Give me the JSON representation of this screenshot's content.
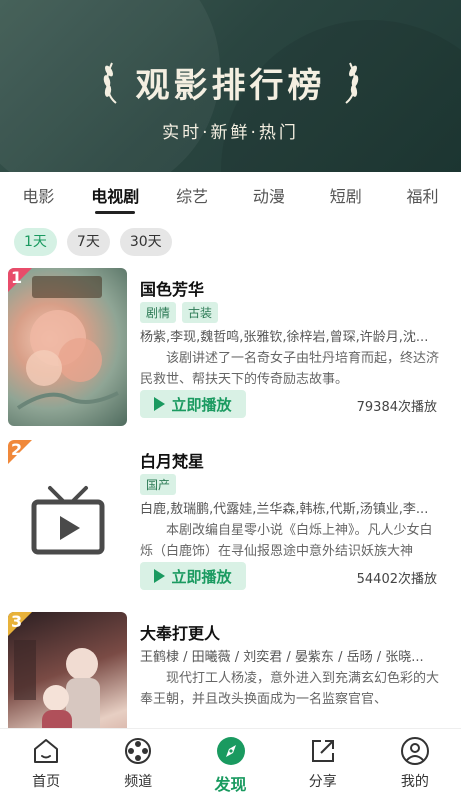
{
  "banner": {
    "title": "观影排行榜",
    "subtitle": "实时·新鲜·热门"
  },
  "tabs": [
    {
      "label": "电影",
      "active": false
    },
    {
      "label": "电视剧",
      "active": true
    },
    {
      "label": "综艺",
      "active": false
    },
    {
      "label": "动漫",
      "active": false
    },
    {
      "label": "短剧",
      "active": false
    },
    {
      "label": "福利",
      "active": false
    }
  ],
  "days": [
    {
      "label": "1天",
      "active": true
    },
    {
      "label": "7天",
      "active": false
    },
    {
      "label": "30天",
      "active": false
    }
  ],
  "items": [
    {
      "rank": "1",
      "rank_color": "#e84c6a",
      "title": "国色芳华",
      "tags": [
        "剧情",
        "古装"
      ],
      "cast": "杨紫,李现,魏哲鸣,张雅钦,徐梓岩,曾琛,许龄月,沈...",
      "desc": "该剧讲述了一名奇女子由牡丹培育而起，终达济民救世、帮扶天下的传奇励志故事。",
      "play_label": "立即播放",
      "count": "79384次播放",
      "poster_colors": [
        "#c9a890",
        "#e8b9a4",
        "#6f8a7a"
      ]
    },
    {
      "rank": "2",
      "rank_color": "#f0883a",
      "title": "白月梵星",
      "tags": [
        "国产"
      ],
      "cast": "白鹿,敖瑞鹏,代露娃,兰华森,韩栋,代斯,汤镇业,李...",
      "desc": "本剧改编自星零小说《白烁上神》。凡人少女白烁（白鹿饰）在寻仙报恩途中意外结识妖族大神",
      "play_label": "立即播放",
      "count": "54402次播放",
      "poster_colors": []
    },
    {
      "rank": "3",
      "rank_color": "#e8b23a",
      "title": "大奉打更人",
      "tags": [],
      "cast": "王鹤棣 / 田曦薇 / 刘奕君 / 晏紫东 / 岳旸 / 张晓...",
      "desc": "现代打工人杨凌，意外进入到充满玄幻色彩的大奉王朝，并且改头换面成为一名监察官官、",
      "play_label": "",
      "count": "",
      "poster_colors": [
        "#b88a7a",
        "#d9c3b8",
        "#5c3b3b"
      ]
    }
  ],
  "nav": [
    {
      "label": "首页",
      "icon": "home-icon",
      "active": false
    },
    {
      "label": "频道",
      "icon": "film-reel-icon",
      "active": false
    },
    {
      "label": "发现",
      "icon": "compass-icon",
      "active": true
    },
    {
      "label": "分享",
      "icon": "share-icon",
      "active": false
    },
    {
      "label": "我的",
      "icon": "user-icon",
      "active": false
    }
  ]
}
